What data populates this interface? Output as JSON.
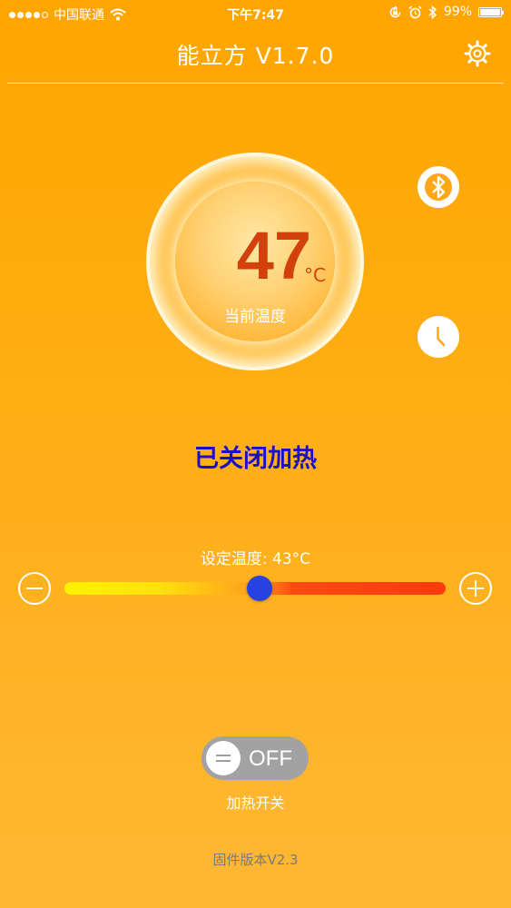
{
  "status_bar": {
    "carrier": "中国联通",
    "time": "下午7:47",
    "battery": "99%",
    "battery_level": 0.99,
    "signal_bars": 4,
    "signal_total": 5,
    "icons": [
      "wifi-icon",
      "orientation-lock-icon",
      "alarm-icon",
      "bluetooth-icon",
      "battery-icon"
    ]
  },
  "nav": {
    "title": "能立方 V1.7.0",
    "settings_icon": "gear-icon"
  },
  "gauge": {
    "temperature": "47",
    "unit": "°C",
    "label": "当前温度"
  },
  "side_buttons": {
    "bluetooth_icon": "bluetooth-icon",
    "timer_icon": "clock-icon"
  },
  "heating": {
    "status": "已关闭加热"
  },
  "slider": {
    "label": "设定温度: 43°C",
    "value": 43,
    "min": 20,
    "max": 65,
    "decrease_icon": "minus-icon",
    "increase_icon": "plus-icon"
  },
  "toggle": {
    "state_text": "OFF",
    "is_on": false,
    "label": "加热开关"
  },
  "footer": {
    "firmware": "固件版本V2.3"
  },
  "colors": {
    "background": "#FFA500",
    "temperature": "#D2410C",
    "heat_status": "#1A0DCC",
    "slider_thumb": "#2742E0",
    "toggle_off": "#A2A2A2",
    "firmware_text": "#7A7A7A"
  }
}
